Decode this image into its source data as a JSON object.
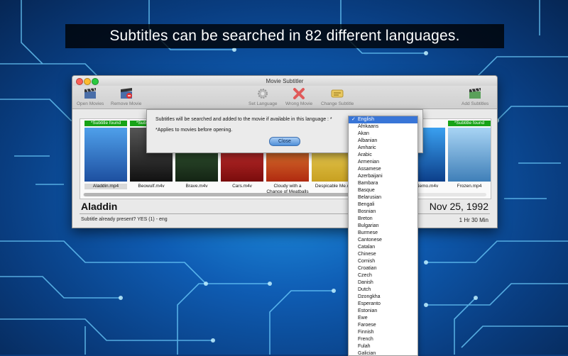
{
  "banner": {
    "text": "Subtitles can be searched in 82 different languages."
  },
  "window": {
    "title": "Movie Subtitler"
  },
  "toolbar": {
    "open_movies": "Open Movies",
    "remove_movie": "Remove Movie",
    "set_language": "Set Language",
    "wrong_movie": "Wrong Movie",
    "change_subtitle": "Change Subtitle",
    "add_subtitles": "Add Subtitles"
  },
  "movies": [
    {
      "name": "Aladdin.mp4",
      "found": "*Subtitle found",
      "color": "#2a6fc6"
    },
    {
      "name": "Beowulf.m4v",
      "found": "*Subtitle found",
      "color": "#2a2a2a"
    },
    {
      "name": "Brave.m4v",
      "found": "",
      "color": "#2c4a2c"
    },
    {
      "name": "Cars.m4v",
      "found": "",
      "color": "#c02020"
    },
    {
      "name": "Cloudy with a Chance of Meatballs",
      "found": "",
      "color": "#d84a1a"
    },
    {
      "name": "Despicable Me.m",
      "found": "",
      "color": "#e8d030"
    },
    {
      "name": "ng Nemo.m4v",
      "found": "",
      "color": "#1b6fc0"
    },
    {
      "name": "Frozen.mp4",
      "found": "*Subtitle found",
      "color": "#6fa8d8"
    }
  ],
  "selected": {
    "title": "Aladdin",
    "date": "Nov 25, 1992",
    "info": "Subtitle already present? YES (1) -  eng",
    "runtime": "1 Hr 30 Min"
  },
  "sheet": {
    "message": "Subtitles will be searched and added to the movie if available in this language : *",
    "note": "*Applies to movies before opening.",
    "close_label": "Close"
  },
  "languages": {
    "selected": "English",
    "items": [
      "English",
      "Afrikaans",
      "Akan",
      "Albanian",
      "Amharic",
      "Arabic",
      "Armenian",
      "Assamese",
      "Azerbaijani",
      "Bambara",
      "Basque",
      "Belarusian",
      "Bengali",
      "Bosnian",
      "Breton",
      "Bulgarian",
      "Burmese",
      "Cantonese",
      "Catalan",
      "Chinese",
      "Cornish",
      "Croatian",
      "Czech",
      "Danish",
      "Dutch",
      "Dzongkha",
      "Esperanto",
      "Estonian",
      "Ewe",
      "Faroese",
      "Finnish",
      "French",
      "Fulah",
      "Galician"
    ]
  }
}
